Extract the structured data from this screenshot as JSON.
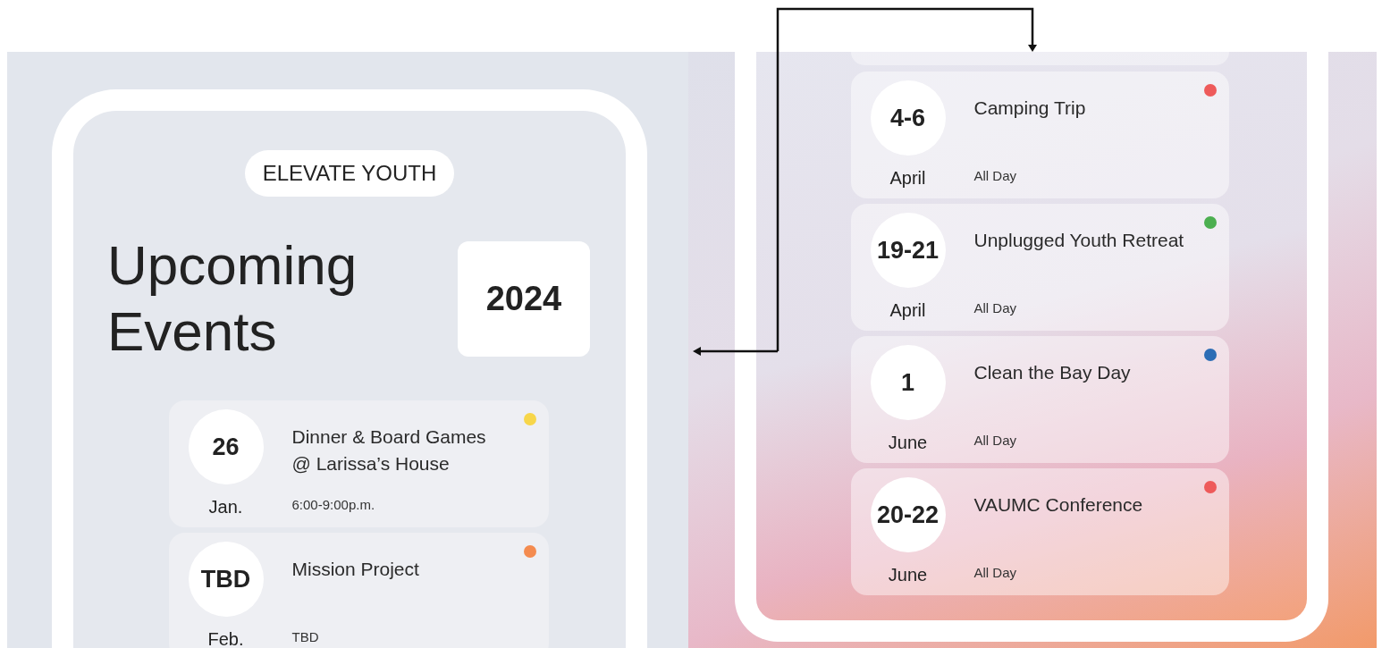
{
  "left_screen": {
    "badge": "ELEVATE YOUTH",
    "heading": [
      "Upcoming",
      "Events"
    ],
    "year": "2024",
    "events": [
      {
        "date": "26",
        "month": "Jan.",
        "title": "Dinner & Board Games @ Larissa’s House",
        "time": "6:00-9:00p.m.",
        "color": "#f7d64a"
      },
      {
        "date": "TBD",
        "month": "Feb.",
        "title": "Mission Project",
        "time": "TBD",
        "color": "#f48b4f"
      }
    ]
  },
  "right_screen": {
    "events": [
      {
        "date": "4-6",
        "month": "April",
        "title": "Camping Trip",
        "time": "All Day",
        "color": "#ee5a5a"
      },
      {
        "date": "19-21",
        "month": "April",
        "title": "Unplugged Youth Retreat",
        "time": "All Day",
        "color": "#4caf50"
      },
      {
        "date": "1",
        "month": "June",
        "title": "Clean the Bay Day",
        "time": "All Day",
        "color": "#2c6db5"
      },
      {
        "date": "20-22",
        "month": "June",
        "title": "VAUMC Conference",
        "time": "All Day",
        "color": "#ee5a5a"
      }
    ]
  }
}
